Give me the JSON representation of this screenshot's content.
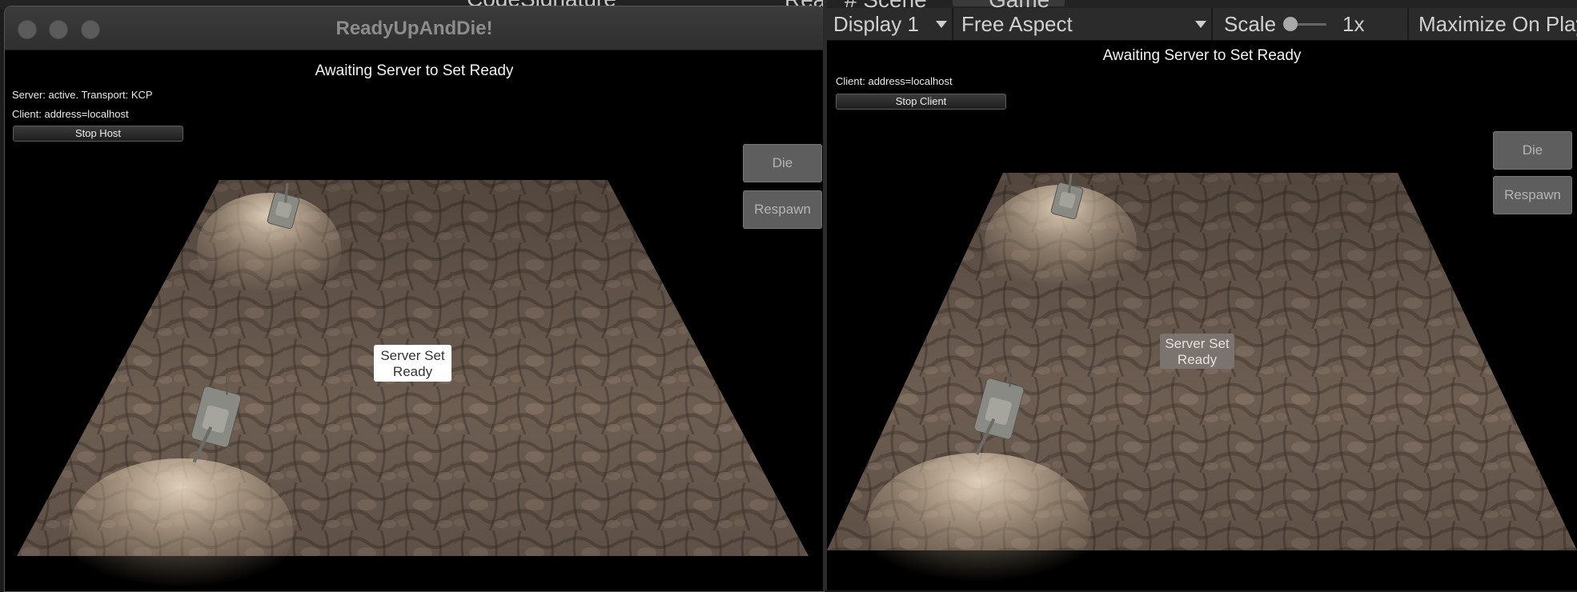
{
  "editor_bg": {
    "tab_scene": "# Scene",
    "tab_game": "Game",
    "doc_name": "CodeSignature",
    "trailing": "Rea"
  },
  "host_window": {
    "title": "ReadyUpAndDie!",
    "status": "Awaiting Server to Set Ready",
    "server_info": "Server: active. Transport: KCP",
    "client_info": "Client: address=localhost",
    "stop_button": "Stop Host",
    "die_button": "Die",
    "respawn_button": "Respawn",
    "ready_button_line1": "Server Set",
    "ready_button_line2": "Ready"
  },
  "game_view": {
    "toolbar": {
      "display": "Display 1",
      "aspect": "Free Aspect",
      "scale_label": "Scale",
      "scale_value": "1x",
      "maximize": "Maximize On Play"
    },
    "status": "Awaiting Server to Set Ready",
    "client_info": "Client: address=localhost",
    "stop_button": "Stop Client",
    "die_button": "Die",
    "respawn_button": "Respawn",
    "ready_button_line1": "Server Set",
    "ready_button_line2": "Ready"
  },
  "colors": {
    "ground_base": "#6e5e52",
    "ground_highlight": "#d8c2a8",
    "tank": "#8a8a84"
  }
}
